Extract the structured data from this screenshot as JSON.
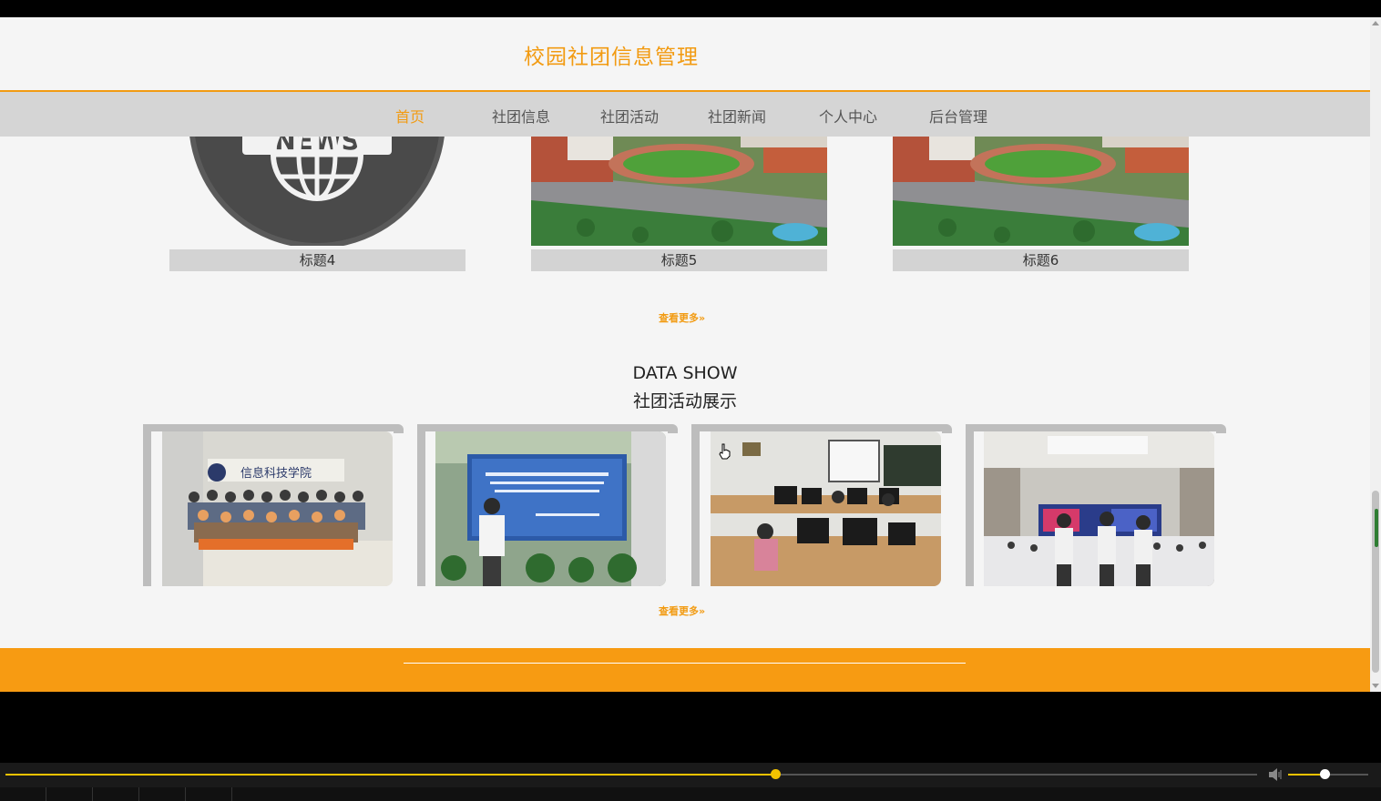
{
  "header": {
    "site_title": "校园社团信息管理"
  },
  "nav": {
    "items": [
      {
        "label": "首页",
        "active": true
      },
      {
        "label": "社团信息",
        "active": false
      },
      {
        "label": "社团活动",
        "active": false
      },
      {
        "label": "社团新闻",
        "active": false
      },
      {
        "label": "个人中心",
        "active": false
      },
      {
        "label": "后台管理",
        "active": false
      }
    ]
  },
  "news": {
    "cards": [
      {
        "caption": "标题4",
        "image": "news-globe-icon"
      },
      {
        "caption": "标题5",
        "image": "campus-aerial-image"
      },
      {
        "caption": "标题6",
        "image": "campus-aerial-image"
      }
    ],
    "more_label": "查看更多"
  },
  "data_show": {
    "title_en": "DATA SHOW",
    "title_cn": "社团活动展示",
    "more_label": "查看更多",
    "photos": [
      "group-photo",
      "banner-photo",
      "computer-lab-photo",
      "conference-photo"
    ]
  },
  "player": {
    "progress": 0.615,
    "volume": 0.45
  },
  "colors": {
    "accent": "#f29b12",
    "footer": "#f79b12",
    "nav_bg": "#d5d5d5",
    "player_accent": "#f2c200"
  }
}
